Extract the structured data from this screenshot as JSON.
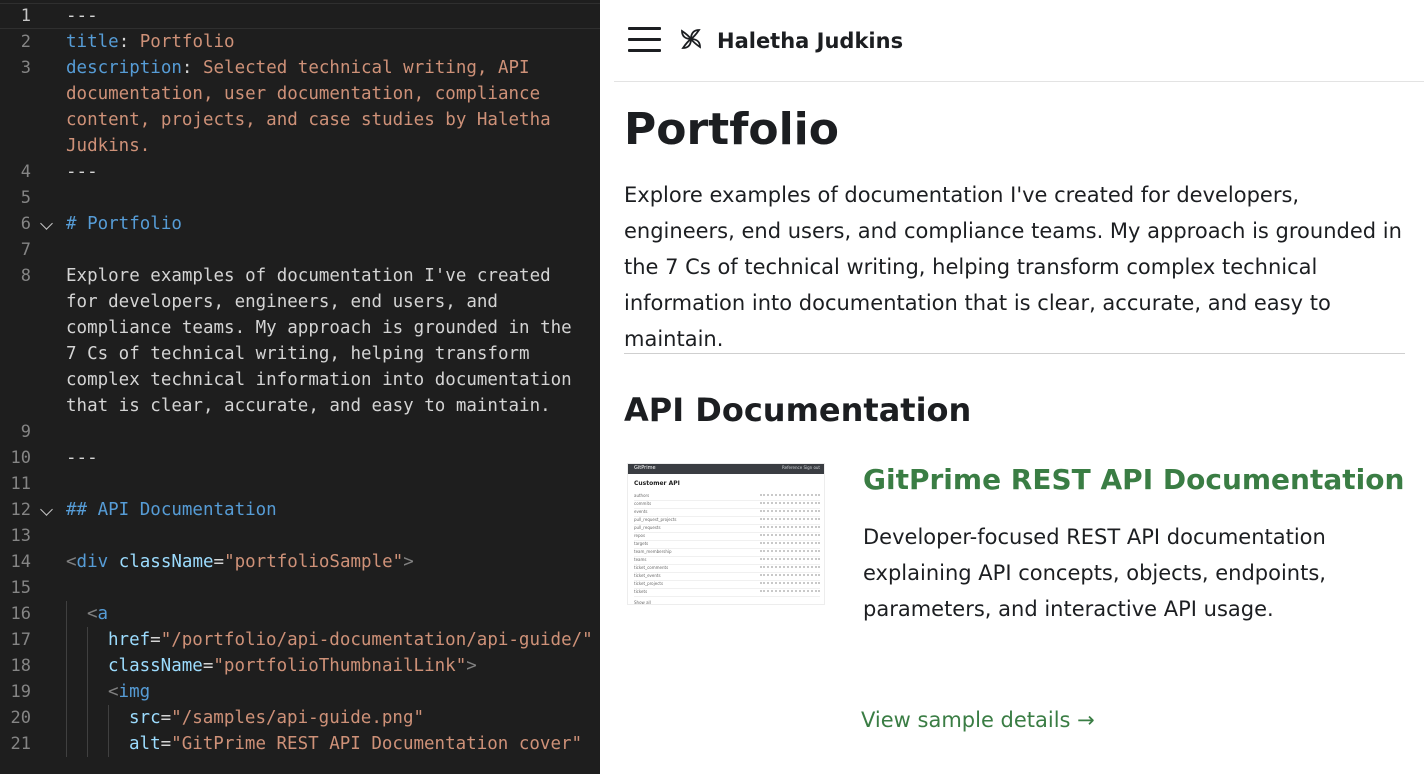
{
  "editor": {
    "lines": [
      {
        "num": "1",
        "segs": [
          {
            "c": "plain",
            "t": "---"
          }
        ]
      },
      {
        "num": "2",
        "segs": [
          {
            "c": "key",
            "t": "title"
          },
          {
            "c": "plain",
            "t": ": "
          },
          {
            "c": "str",
            "t": "Portfolio"
          }
        ]
      },
      {
        "num": "3",
        "segs": [
          {
            "c": "key",
            "t": "description"
          },
          {
            "c": "plain",
            "t": ": "
          },
          {
            "c": "str",
            "t": "Selected technical writing, API"
          }
        ]
      },
      {
        "num": "",
        "segs": [
          {
            "c": "str",
            "t": "documentation, user documentation, compliance"
          }
        ]
      },
      {
        "num": "",
        "segs": [
          {
            "c": "str",
            "t": "content, projects, and case studies by Haletha"
          }
        ]
      },
      {
        "num": "",
        "segs": [
          {
            "c": "str",
            "t": "Judkins."
          }
        ]
      },
      {
        "num": "4",
        "segs": [
          {
            "c": "plain",
            "t": "---"
          }
        ]
      },
      {
        "num": "5",
        "segs": []
      },
      {
        "num": "6",
        "fold": true,
        "segs": [
          {
            "c": "head",
            "t": "# Portfolio"
          }
        ]
      },
      {
        "num": "7",
        "segs": []
      },
      {
        "num": "8",
        "segs": [
          {
            "c": "plain",
            "t": "Explore examples of documentation I've created"
          }
        ]
      },
      {
        "num": "",
        "segs": [
          {
            "c": "plain",
            "t": "for developers, engineers, end users, and"
          }
        ]
      },
      {
        "num": "",
        "segs": [
          {
            "c": "plain",
            "t": "compliance teams. My approach is grounded in the"
          }
        ]
      },
      {
        "num": "",
        "segs": [
          {
            "c": "plain",
            "t": "7 Cs of technical writing, helping transform"
          }
        ]
      },
      {
        "num": "",
        "segs": [
          {
            "c": "plain",
            "t": "complex technical information into documentation"
          }
        ]
      },
      {
        "num": "",
        "segs": [
          {
            "c": "plain",
            "t": "that is clear, accurate, and easy to maintain."
          }
        ]
      },
      {
        "num": "9",
        "segs": []
      },
      {
        "num": "10",
        "segs": [
          {
            "c": "plain",
            "t": "---"
          }
        ]
      },
      {
        "num": "11",
        "segs": []
      },
      {
        "num": "12",
        "fold": true,
        "segs": [
          {
            "c": "head",
            "t": "## API Documentation"
          }
        ]
      },
      {
        "num": "13",
        "segs": []
      },
      {
        "num": "14",
        "segs": [
          {
            "c": "punct",
            "t": "<"
          },
          {
            "c": "tag",
            "t": "div"
          },
          {
            "c": "plain",
            "t": " "
          },
          {
            "c": "attr",
            "t": "className"
          },
          {
            "c": "plain",
            "t": "="
          },
          {
            "c": "str",
            "t": "\"portfolioSample\""
          },
          {
            "c": "punct",
            "t": ">"
          }
        ]
      },
      {
        "num": "15",
        "segs": []
      },
      {
        "num": "16",
        "indent": 1,
        "segs": [
          {
            "c": "punct",
            "t": "<"
          },
          {
            "c": "tag",
            "t": "a"
          }
        ]
      },
      {
        "num": "17",
        "indent": 2,
        "segs": [
          {
            "c": "attr",
            "t": "href"
          },
          {
            "c": "plain",
            "t": "="
          },
          {
            "c": "str",
            "t": "\"/portfolio/api-documentation/api-guide/\""
          }
        ]
      },
      {
        "num": "18",
        "indent": 2,
        "segs": [
          {
            "c": "attr",
            "t": "className"
          },
          {
            "c": "plain",
            "t": "="
          },
          {
            "c": "str",
            "t": "\"portfolioThumbnailLink\""
          },
          {
            "c": "punct",
            "t": ">"
          }
        ]
      },
      {
        "num": "19",
        "indent": 2,
        "segs": [
          {
            "c": "punct",
            "t": "<"
          },
          {
            "c": "tag",
            "t": "img"
          }
        ]
      },
      {
        "num": "20",
        "indent": 3,
        "segs": [
          {
            "c": "attr",
            "t": "src"
          },
          {
            "c": "plain",
            "t": "="
          },
          {
            "c": "str",
            "t": "\"/samples/api-guide.png\""
          }
        ]
      },
      {
        "num": "21",
        "indent": 3,
        "segs": [
          {
            "c": "attr",
            "t": "alt"
          },
          {
            "c": "plain",
            "t": "="
          },
          {
            "c": "str",
            "t": "\"GitPrime REST API Documentation cover\""
          }
        ]
      }
    ]
  },
  "preview": {
    "site_title": "Haletha Judkins",
    "page_title": "Portfolio",
    "intro": "Explore examples of documentation I've created for developers, engineers, end users, and compliance teams. My approach is grounded in the 7 Cs of technical writing, helping transform complex technical information into documentation that is clear, accurate, and easy to maintain.",
    "section_title": "API Documentation",
    "card": {
      "title": "GitPrime REST API Documentation",
      "description": "Developer-focused REST API documentation explaining API concepts, objects, endpoints, parameters, and interactive API usage.",
      "link": "View sample details →"
    },
    "thumbnail": {
      "brand": "GitPrime",
      "nav_right": "Reference    Sign out",
      "heading": "Customer API",
      "rows": [
        "authors",
        "commits",
        "events",
        "pull_request_projects",
        "pull_requests",
        "repos",
        "targets",
        "team_membership",
        "teams",
        "ticket_comments",
        "ticket_events",
        "ticket_projects",
        "tickets"
      ],
      "footer": "Show all"
    },
    "colors": {
      "accent": "#3a7d44",
      "text": "#1c1e21"
    }
  }
}
